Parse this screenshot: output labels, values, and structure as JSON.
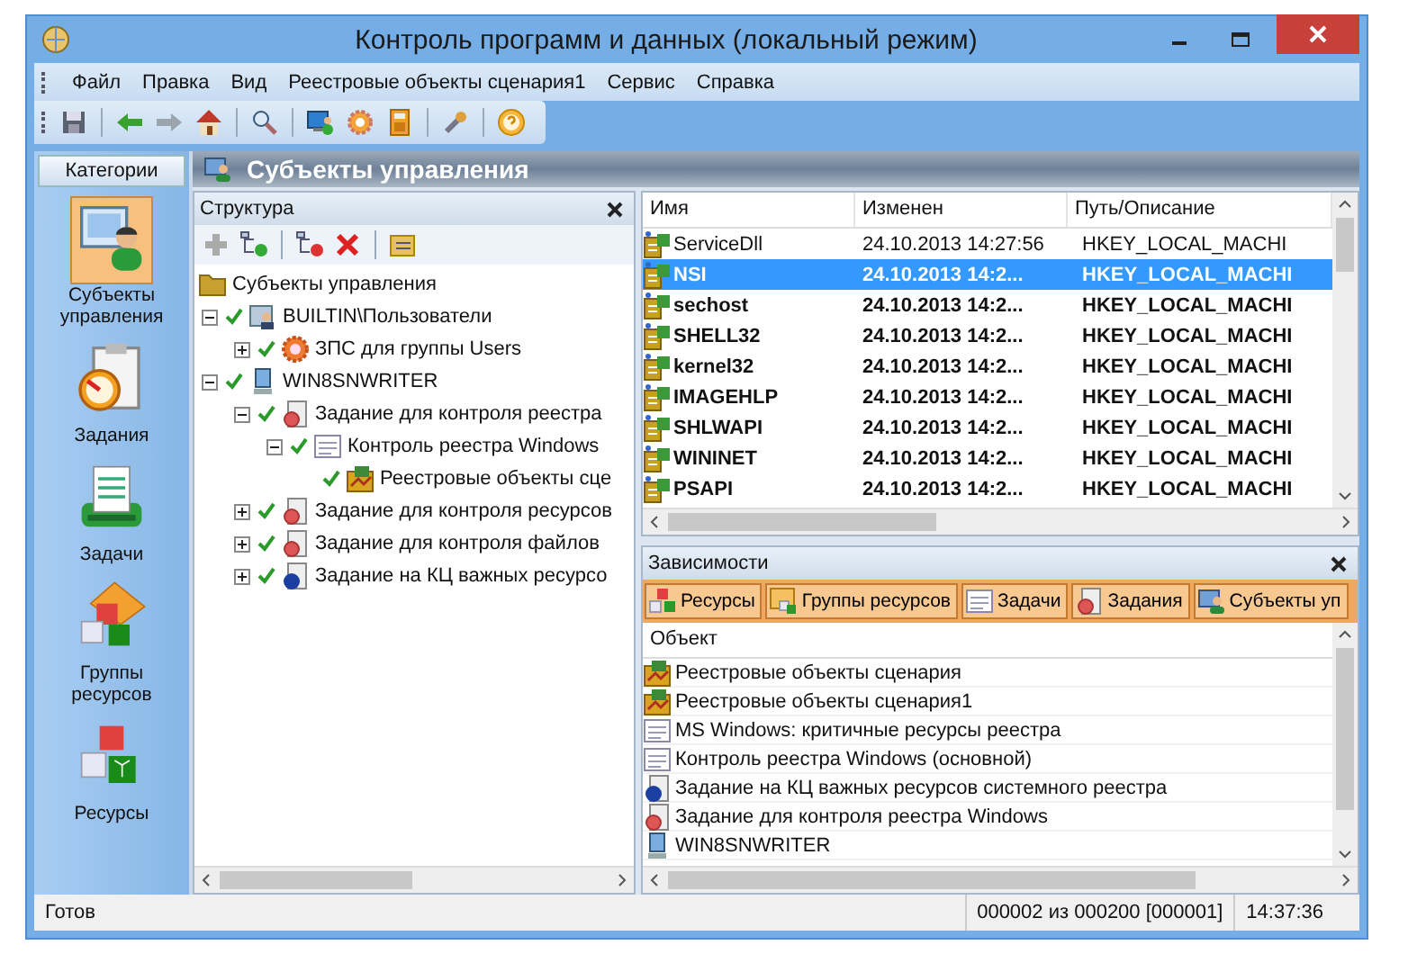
{
  "window": {
    "title": "Контроль программ и данных (локальный режим)"
  },
  "menu": [
    "Файл",
    "Правка",
    "Вид",
    "Реестровые объекты сценария1",
    "Сервис",
    "Справка"
  ],
  "categories": {
    "title": "Категории",
    "items": [
      {
        "label": "Субъекты управления",
        "kind": "subjects",
        "selected": true
      },
      {
        "label": "Задания",
        "kind": "jobs",
        "selected": false
      },
      {
        "label": "Задачи",
        "kind": "tasks",
        "selected": false
      },
      {
        "label": "Группы ресурсов",
        "kind": "groups",
        "selected": false
      },
      {
        "label": "Ресурсы",
        "kind": "resources",
        "selected": false
      }
    ]
  },
  "main_header": {
    "title": "Субъекты управления"
  },
  "structure": {
    "title": "Структура",
    "tree": [
      {
        "label": "Субъекты управления",
        "kind": "folder",
        "checked": false,
        "children": [
          {
            "label": "BUILTIN\\Пользователи",
            "kind": "users",
            "checked": true,
            "expanded": true,
            "children": [
              {
                "label": "ЗПС для группы Users",
                "kind": "policy",
                "checked": true,
                "expanded": false
              }
            ]
          },
          {
            "label": "WIN8SNWRITER",
            "kind": "computer",
            "checked": true,
            "expanded": true,
            "children": [
              {
                "label": "Задание для контроля реестра",
                "kind": "job",
                "checked": true,
                "expanded": true,
                "children": [
                  {
                    "label": "Контроль реестра Windows",
                    "kind": "task",
                    "checked": true,
                    "expanded": true,
                    "children": [
                      {
                        "label": "Реестровые объекты сце",
                        "kind": "regset",
                        "checked": true
                      }
                    ]
                  }
                ]
              },
              {
                "label": "Задание для контроля ресурсов",
                "kind": "job",
                "checked": true,
                "expanded": false
              },
              {
                "label": "Задание для контроля файлов",
                "kind": "job",
                "checked": true,
                "expanded": false
              },
              {
                "label": "Задание на КЦ важных ресурсо",
                "kind": "balljob",
                "checked": true,
                "expanded": false
              }
            ]
          }
        ]
      }
    ]
  },
  "table": {
    "columns": [
      "Имя",
      "Изменен",
      "Путь/Описание"
    ],
    "rows": [
      {
        "name": "ServiceDll",
        "changed": "24.10.2013   14:27:56",
        "path": "HKEY_LOCAL_MACHI",
        "selected": false,
        "bold": false
      },
      {
        "name": "NSI",
        "changed": "24.10.2013   14:2...",
        "path": "HKEY_LOCAL_MACHI",
        "selected": true,
        "bold": true
      },
      {
        "name": "sechost",
        "changed": "24.10.2013   14:2...",
        "path": "HKEY_LOCAL_MACHI",
        "selected": false,
        "bold": true
      },
      {
        "name": "SHELL32",
        "changed": "24.10.2013   14:2...",
        "path": "HKEY_LOCAL_MACHI",
        "selected": false,
        "bold": true
      },
      {
        "name": "kernel32",
        "changed": "24.10.2013   14:2...",
        "path": "HKEY_LOCAL_MACHI",
        "selected": false,
        "bold": true
      },
      {
        "name": "IMAGEHLP",
        "changed": "24.10.2013   14:2...",
        "path": "HKEY_LOCAL_MACHI",
        "selected": false,
        "bold": true
      },
      {
        "name": "SHLWAPI",
        "changed": "24.10.2013   14:2...",
        "path": "HKEY_LOCAL_MACHI",
        "selected": false,
        "bold": true
      },
      {
        "name": "WININET",
        "changed": "24.10.2013   14:2...",
        "path": "HKEY_LOCAL_MACHI",
        "selected": false,
        "bold": true
      },
      {
        "name": "PSAPI",
        "changed": "24.10.2013   14:2...",
        "path": "HKEY_LOCAL_MACHI",
        "selected": false,
        "bold": true
      }
    ]
  },
  "dependencies": {
    "title": "Зависимости",
    "tabs": [
      {
        "label": "Ресурсы",
        "kind": "resources"
      },
      {
        "label": "Группы ресурсов",
        "kind": "groups"
      },
      {
        "label": "Задачи",
        "kind": "task"
      },
      {
        "label": "Задания",
        "kind": "job"
      },
      {
        "label": "Субъекты уп",
        "kind": "subjects"
      }
    ],
    "column": "Объект",
    "items": [
      {
        "label": "Реестровые объекты сценария",
        "kind": "regset"
      },
      {
        "label": "Реестровые объекты сценария1",
        "kind": "regset"
      },
      {
        "label": "MS Windows: критичные ресурсы реестра",
        "kind": "task"
      },
      {
        "label": "Контроль реестра Windows (основной)",
        "kind": "task"
      },
      {
        "label": "Задание на КЦ важных ресурсов системного реестра",
        "kind": "balljob"
      },
      {
        "label": "Задание для контроля реестра Windows",
        "kind": "job"
      },
      {
        "label": "WIN8SNWRITER",
        "kind": "computer"
      }
    ]
  },
  "status_bar": [
    "Готов",
    "000002 из 000200 [000001]",
    "14:37:36"
  ]
}
